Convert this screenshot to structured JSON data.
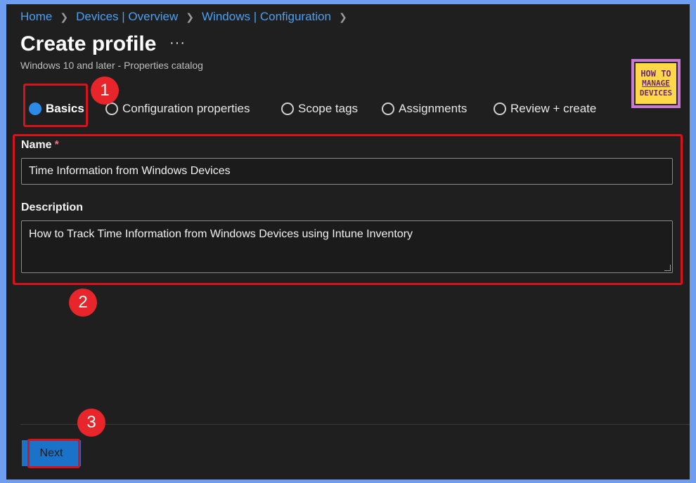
{
  "breadcrumb": [
    "Home",
    "Devices | Overview",
    "Windows | Configuration"
  ],
  "page": {
    "title": "Create profile",
    "more_label": "···",
    "subtitle": "Windows 10 and later - Properties catalog"
  },
  "logo": {
    "line1": "HOW TO",
    "line2": "MANAGE",
    "line3": "DEVICES"
  },
  "steps": [
    {
      "label": "Basics",
      "state": "active"
    },
    {
      "label": "Configuration properties",
      "state": "pending"
    },
    {
      "label": "Scope tags",
      "state": "pending"
    },
    {
      "label": "Assignments",
      "state": "pending"
    },
    {
      "label": "Review + create",
      "state": "pending"
    }
  ],
  "form": {
    "name_label": "Name",
    "required_mark": "*",
    "name_value": "Time Information from Windows Devices",
    "description_label": "Description",
    "description_value": "How to Track Time Information from Windows Devices using Intune Inventory"
  },
  "annotations": {
    "badge1": "1",
    "badge2": "2",
    "badge3": "3"
  },
  "footer": {
    "next_label": "Next"
  },
  "colors": {
    "accent": "#2c8ae8",
    "annotation_red": "#d8121b",
    "background": "#1f1f1f",
    "frame": "#6f9ef0"
  }
}
